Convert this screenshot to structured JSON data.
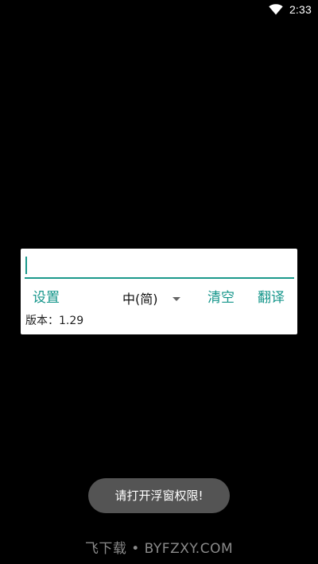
{
  "status_bar": {
    "time": "2:33",
    "wifi_icon": "wifi-icon"
  },
  "panel": {
    "input": {
      "value": "",
      "placeholder": ""
    },
    "settings_label": "设置",
    "language": {
      "selected": "中(简)",
      "caret_icon": "chevron-down-icon"
    },
    "clear_label": "清空",
    "translate_label": "翻译",
    "version_text": "版本：1.29"
  },
  "toast": {
    "message": "请打开浮窗权限!"
  },
  "watermark": {
    "text": "飞下载 • BYFZXY.COM"
  },
  "colors": {
    "accent": "#14958a",
    "background": "#000000",
    "panel": "#ffffff",
    "toast": "#545454"
  }
}
